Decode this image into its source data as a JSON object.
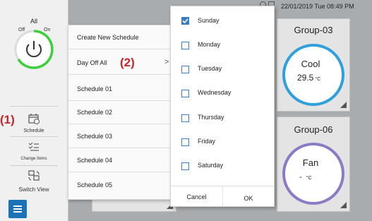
{
  "status": {
    "datetime": "22/01/2019 Tue 08:49 PM"
  },
  "sidebar": {
    "all_label": "All",
    "off_label": "Off",
    "on_label": "On",
    "schedule_label": "Schedule",
    "change_items_label": "Change Items",
    "switch_view_label": "Switch View",
    "callout_1": "(1)"
  },
  "menu": {
    "items": [
      "Create New Schedule",
      "Day Off All",
      "Schedule 01",
      "Schedule 02",
      "Schedule 03",
      "Schedule 04",
      "Schedule 05"
    ],
    "callout_2": "(2)",
    "chevron": ">"
  },
  "popup": {
    "days": [
      {
        "label": "Sunday",
        "checked": true
      },
      {
        "label": "Monday",
        "checked": false
      },
      {
        "label": "Tuesday",
        "checked": false
      },
      {
        "label": "Wednesday",
        "checked": false
      },
      {
        "label": "Thursday",
        "checked": false
      },
      {
        "label": "Friday",
        "checked": false
      },
      {
        "label": "Saturday",
        "checked": false
      }
    ],
    "cancel_label": "Cancel",
    "ok_label": "OK"
  },
  "cards": [
    {
      "title": "Group-03",
      "mode": "Cool",
      "temp": "29.5",
      "unit": "°C",
      "ring_color": "#2fa0dc"
    },
    {
      "title": "Group-06",
      "mode": "Fan",
      "temp": "-",
      "unit": "°C",
      "ring_color": "#8c7bc4"
    }
  ],
  "colors": {
    "power_ring_on": "#3ccf3c",
    "accent": "#1a73b8",
    "callout": "#c4232b"
  }
}
